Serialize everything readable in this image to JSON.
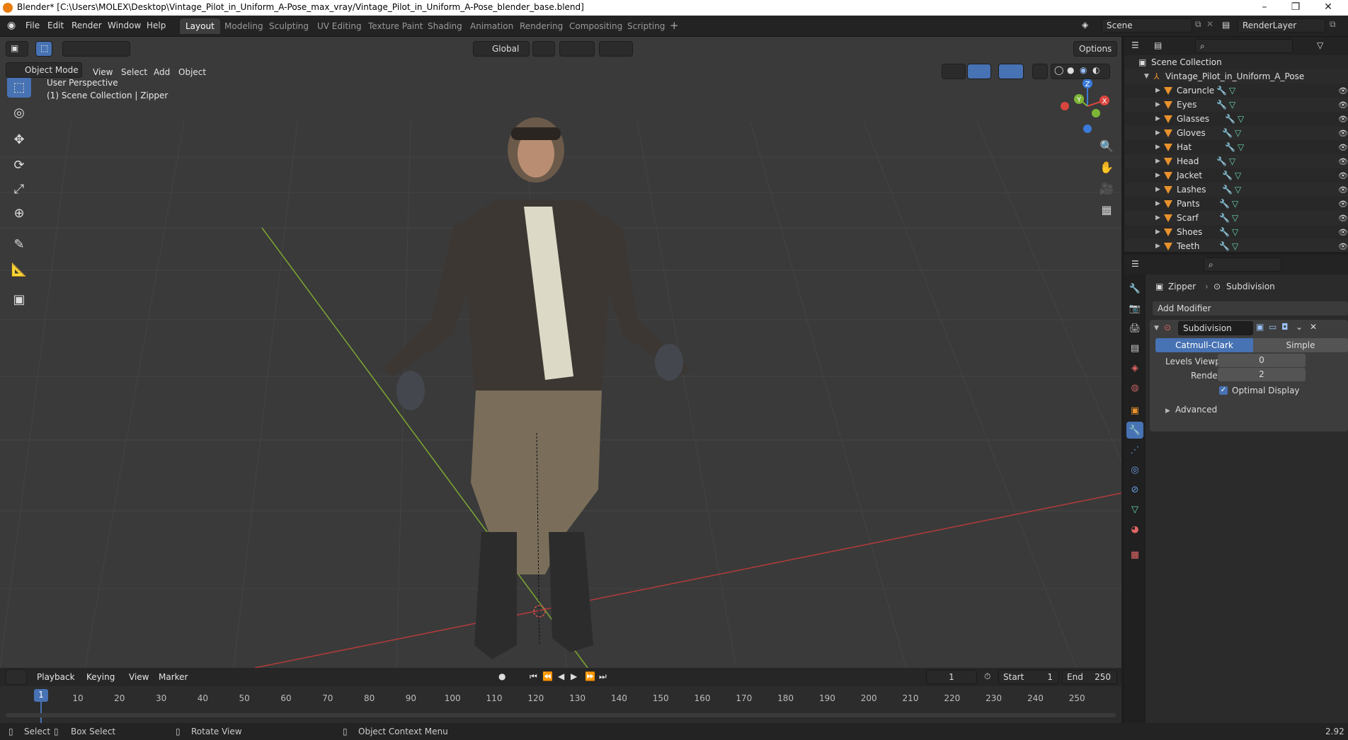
{
  "app": {
    "title": "Blender* [C:\\Users\\MOLEX\\Desktop\\Vintage_Pilot_in_Uniform_A-Pose_max_vray/Vintage_Pilot_in_Uniform_A-Pose_blender_base.blend]"
  },
  "menu": {
    "items": [
      "File",
      "Edit",
      "Render",
      "Window",
      "Help"
    ]
  },
  "workspaces": [
    "Layout",
    "Modeling",
    "Sculpting",
    "UV Editing",
    "Texture Paint",
    "Shading",
    "Animation",
    "Rendering",
    "Compositing",
    "Scripting"
  ],
  "active_workspace": "Layout",
  "scene": {
    "name": "Scene",
    "view_layer": "RenderLayer"
  },
  "viewport": {
    "mode": "Object Mode",
    "menus": [
      "View",
      "Select",
      "Add",
      "Object"
    ],
    "transform_orientation": "Global",
    "options_label": "Options",
    "overlay_text_1": "User Perspective",
    "overlay_text_2": "(1) Scene Collection | Zipper",
    "gizmo": {
      "z": "Z",
      "y": "Y",
      "x": "X"
    },
    "colors": {
      "background": "#3a3a3a",
      "x_axis": "#b53a3a",
      "y_axis": "#7da832",
      "accent": "#4772b3"
    }
  },
  "tools": [
    "select-box",
    "cursor",
    "move",
    "rotate",
    "scale",
    "transform",
    "annotate",
    "measure",
    "add-cube"
  ],
  "outliner": {
    "root": "Scene Collection",
    "collection": "Vintage_Pilot_in_Uniform_A_Pose",
    "objects": [
      "Caruncle",
      "Eyes",
      "Glasses",
      "Gloves",
      "Hat",
      "Head",
      "Jacket",
      "Lashes",
      "Pants",
      "Scarf",
      "Shoes",
      "Teeth"
    ]
  },
  "properties": {
    "object": "Zipper",
    "modifier_context": "Subdivision",
    "add_modifier": "Add Modifier",
    "modifier": {
      "name": "Subdivision",
      "types": [
        "Catmull-Clark",
        "Simple"
      ],
      "active_type": "Catmull-Clark",
      "levels_viewport_label": "Levels Viewport",
      "levels_viewport": "0",
      "render_label": "Render",
      "render": "2",
      "optimal_display_label": "Optimal Display",
      "optimal_display": true,
      "advanced_label": "Advanced"
    }
  },
  "timeline": {
    "menus": [
      "Playback",
      "Keying",
      "View",
      "Marker"
    ],
    "current_frame": "1",
    "start_label": "Start",
    "start": "1",
    "end_label": "End",
    "end": "250",
    "ticks": [
      "10",
      "20",
      "30",
      "40",
      "50",
      "60",
      "70",
      "80",
      "90",
      "100",
      "110",
      "120",
      "130",
      "140",
      "150",
      "160",
      "170",
      "180",
      "190",
      "200",
      "210",
      "220",
      "230",
      "240",
      "250"
    ],
    "playhead": "1"
  },
  "statusbar": {
    "select": "Select",
    "box_select": "Box Select",
    "rotate_view": "Rotate View",
    "context_menu": "Object Context Menu",
    "version": "2.92"
  }
}
